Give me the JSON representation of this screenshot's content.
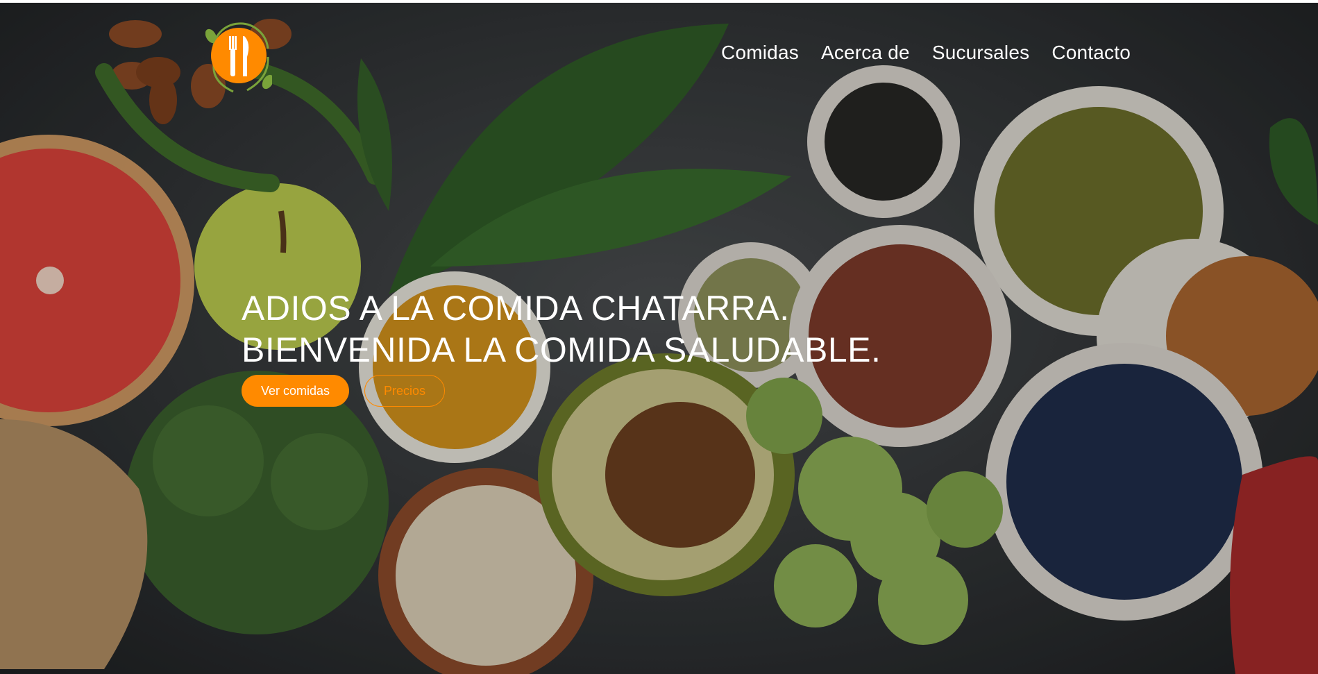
{
  "header": {
    "logo_icon": "fork-knife-icon",
    "nav": [
      {
        "label": "Comidas"
      },
      {
        "label": "Acerca de"
      },
      {
        "label": "Sucursales"
      },
      {
        "label": "Contacto"
      }
    ]
  },
  "hero": {
    "headline_line1": "ADIOS A LA COMIDA CHATARRA.",
    "headline_line2": "BIENVENIDA LA COMIDA SALUDABLE.",
    "primary_button": "Ver comidas",
    "secondary_button": "Precios"
  },
  "colors": {
    "accent": "#ff8a00",
    "text": "#ffffff"
  }
}
